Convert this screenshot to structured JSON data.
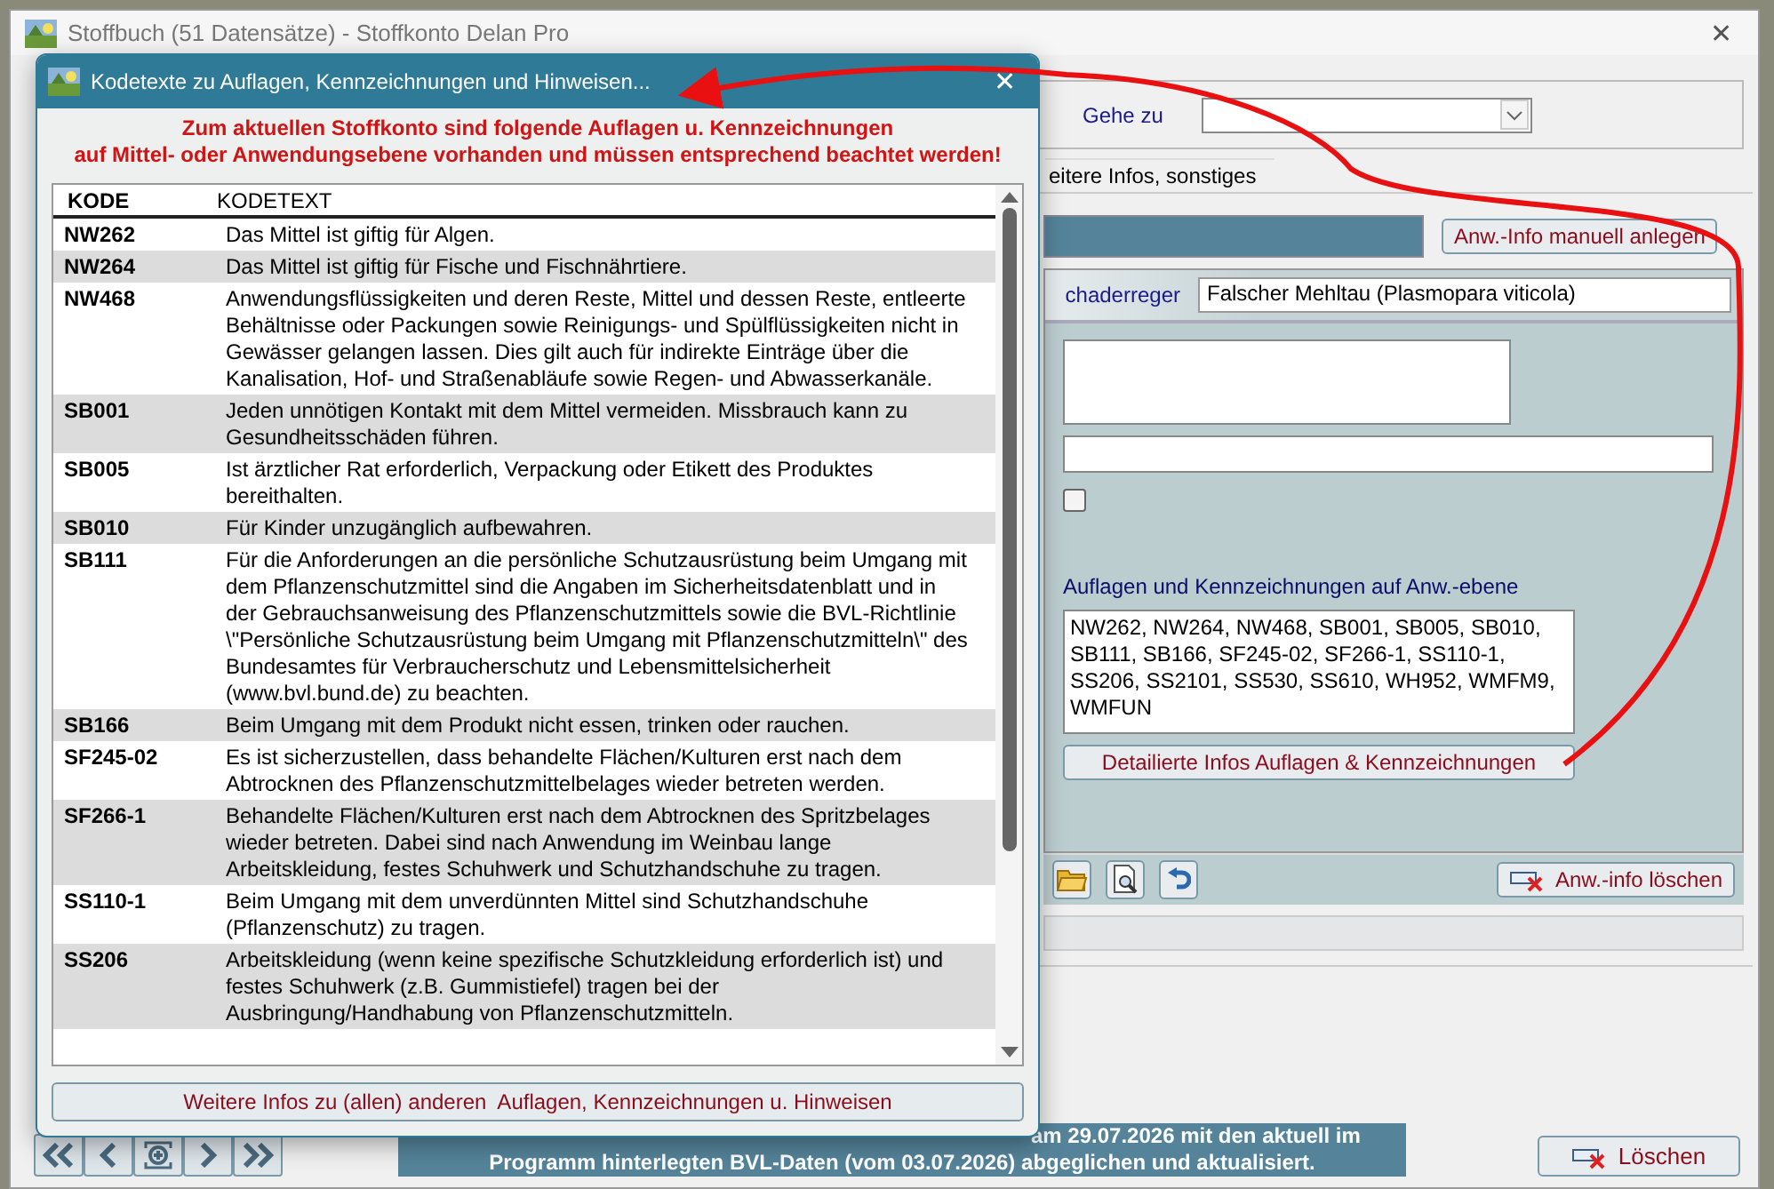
{
  "window": {
    "title": "Stoffbuch (51 Datensätze) - Stoffkonto Delan Pro",
    "close": "✕"
  },
  "goto": {
    "label": "Gehe zu"
  },
  "tabs": [
    {
      "label": "eitere Infos, sonstiges",
      "selected": true
    }
  ],
  "manual_button": "Anw.-Info manuell anlegen",
  "pest_field": {
    "label": "chaderreger",
    "value": "Falscher Mehltau (Plasmopara viticola)"
  },
  "checkbox": {
    "checked": false
  },
  "requirements": {
    "label": "Auflagen und Kennzeichnungen auf Anw.-ebene",
    "value": "NW262, NW264, NW468, SB001, SB005, SB010, SB111, SB166, SF245-02, SF266-1, SS110-1, SS206, SS2101, SS530, SS610, WH952, WMFM9, WMFUN"
  },
  "details_button": "Detailierte Infos Auflagen & Kennzeichnungen",
  "delete_info_button": "Anw.-info löschen",
  "status": [
    "am 29.07.2026 mit den aktuell im",
    "Programm hinterlegten BVL-Daten (vom 03.07.2026) abgeglichen und aktualisiert."
  ],
  "delete_button": "Löschen",
  "dialog": {
    "title": "Kodetexte zu Auflagen, Kennzeichnungen und Hinweisen...",
    "close": "✕",
    "notice": [
      "Zum aktuellen Stoffkonto sind folgende Auflagen u. Kennzeichnungen",
      "auf Mittel- oder Anwendungsebene vorhanden und müssen entsprechend beachtet werden!"
    ],
    "columns": [
      "KODE",
      "KODETEXT"
    ],
    "rows": [
      {
        "code": "NW262",
        "text": "Das Mittel ist giftig für Algen."
      },
      {
        "code": "NW264",
        "text": "Das Mittel ist giftig für Fische und Fischnährtiere."
      },
      {
        "code": "NW468",
        "text": "Anwendungsflüssigkeiten und deren Reste, Mittel und dessen Reste, entleerte Behältnisse oder Packungen sowie Reinigungs- und Spülflüssigkeiten nicht in Gewässer gelangen lassen. Dies gilt auch für indirekte Einträge über die Kanalisation, Hof- und Straßenabläufe sowie Regen- und Abwasserkanäle."
      },
      {
        "code": "SB001",
        "text": "Jeden unnötigen Kontakt mit dem Mittel vermeiden. Missbrauch kann zu Gesundheitsschäden führen."
      },
      {
        "code": "SB005",
        "text": "Ist ärztlicher Rat erforderlich, Verpackung oder Etikett des Produktes bereithalten."
      },
      {
        "code": "SB010",
        "text": "Für Kinder unzugänglich aufbewahren."
      },
      {
        "code": "SB111",
        "text": "Für die Anforderungen an die persönliche Schutzausrüstung beim Umgang mit dem Pflanzenschutzmittel sind die Angaben im Sicherheitsdatenblatt und in der Gebrauchsanweisung des Pflanzenschutzmittels sowie die BVL-Richtlinie \\\"Persönliche Schutzausrüstung beim Umgang mit Pflanzenschutzmitteln\\\" des Bundesamtes für Verbraucherschutz und Lebensmittelsicherheit (www.bvl.bund.de) zu beachten."
      },
      {
        "code": "SB166",
        "text": "Beim Umgang mit dem Produkt nicht essen, trinken oder rauchen."
      },
      {
        "code": "SF245-02",
        "text": "Es ist sicherzustellen, dass behandelte Flächen/Kulturen erst nach dem Abtrocknen des Pflanzenschutzmittelbelages wieder betreten werden."
      },
      {
        "code": "SF266-1",
        "text": "Behandelte Flächen/Kulturen erst nach dem Abtrocknen des Spritzbelages wieder betreten. Dabei sind nach Anwendung im Weinbau lange Arbeitskleidung, festes Schuhwerk und Schutzhandschuhe zu tragen."
      },
      {
        "code": "SS110-1",
        "text": "Beim Umgang mit dem unverdünnten Mittel sind Schutzhandschuhe (Pflanzenschutz) zu tragen."
      },
      {
        "code": "SS206",
        "text": "Arbeitskleidung (wenn keine spezifische Schutzkleidung erforderlich ist) und festes Schuhwerk (z.B. Gummistiefel) tragen bei der Ausbringung/Handhabung von Pflanzenschutzmitteln."
      }
    ],
    "button": "Weitere Infos zu (allen) anderen  Auflagen, Kennzeichnungen u. Hinweisen"
  }
}
